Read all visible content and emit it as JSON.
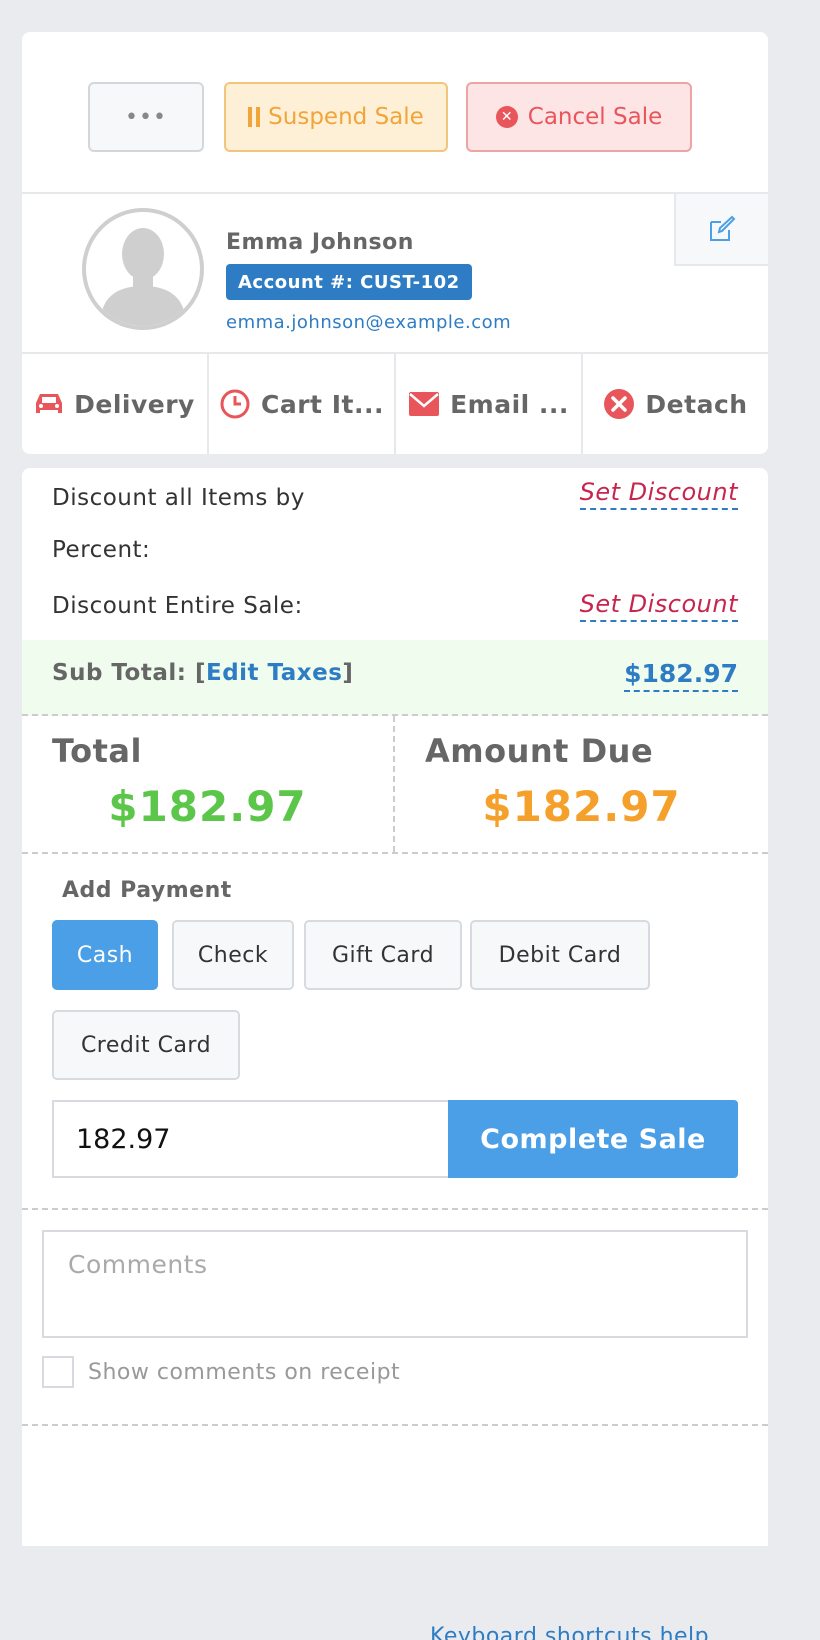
{
  "actions": {
    "more_label": "•••",
    "suspend_label": "Suspend Sale",
    "cancel_label": "Cancel Sale"
  },
  "customer": {
    "name": "Emma Johnson",
    "account": "Account #: CUST-102",
    "email": "emma.johnson@example.com"
  },
  "tabs": [
    {
      "label": "Delivery",
      "icon": "car-icon"
    },
    {
      "label": "Cart It...",
      "icon": "clock-icon"
    },
    {
      "label": "Email ...",
      "icon": "envelope-icon"
    },
    {
      "label": "Detach",
      "icon": "x-circle-icon"
    }
  ],
  "discounts": {
    "items_label_line1": "Discount all Items by",
    "items_label_line2": "Percent:",
    "sale_label": "Discount Entire Sale:",
    "set_discount": "Set Discount"
  },
  "subtotal": {
    "label": "Sub Total:",
    "edit_taxes": "Edit Taxes",
    "value": "$182.97"
  },
  "totals": {
    "total_label": "Total",
    "total_value": "$182.97",
    "due_label": "Amount Due",
    "due_value": "$182.97"
  },
  "payment": {
    "title": "Add Payment",
    "methods": [
      "Cash",
      "Check",
      "Gift Card",
      "Debit Card",
      "Credit Card"
    ],
    "active": "Cash",
    "amount": "182.97",
    "complete_label": "Complete Sale"
  },
  "comments": {
    "placeholder": "Comments",
    "show_on_receipt": "Show comments on receipt"
  },
  "footer": {
    "link": "Keyboard shortcuts help"
  },
  "colors": {
    "total_green": "#5cc64a",
    "due_orange": "#f5a02a",
    "accent_blue": "#4a9fe6",
    "link_blue": "#2e7dc4",
    "icon_red": "#e8565c"
  }
}
